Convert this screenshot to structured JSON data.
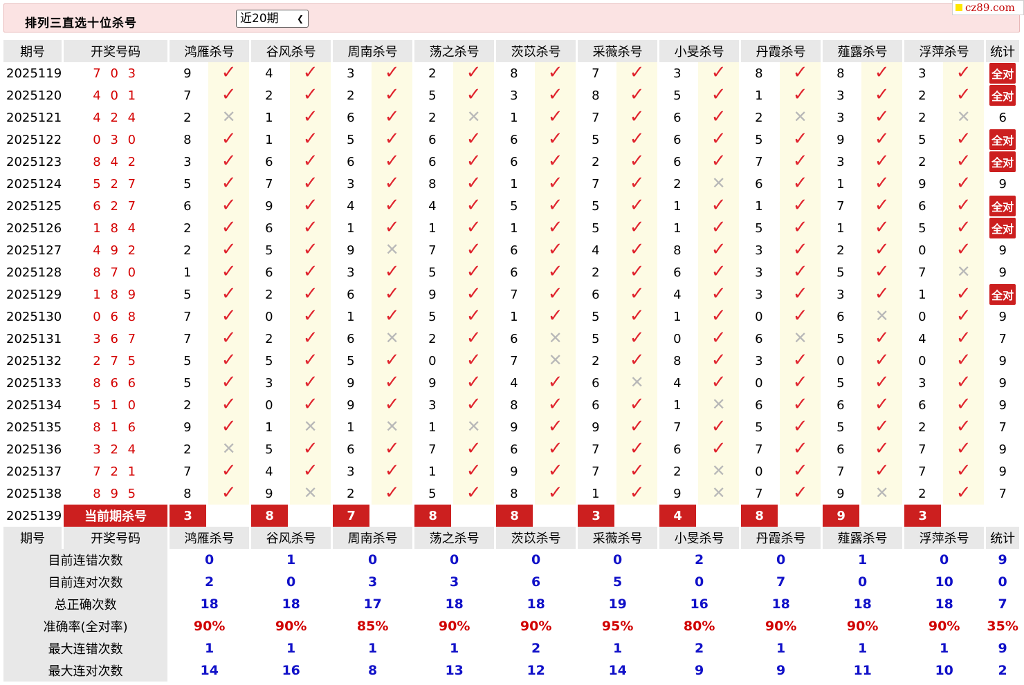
{
  "header": {
    "title": "排列三直选十位杀号",
    "period_select": "近20期",
    "logo": "cz89.com"
  },
  "columns": {
    "issue": "期号",
    "draw": "开奖号码",
    "experts": [
      "鸿雁杀号",
      "谷风杀号",
      "周南杀号",
      "荡之杀号",
      "茨苡杀号",
      "采薇杀号",
      "小旻杀号",
      "丹霞杀号",
      "薤露杀号",
      "浮萍杀号"
    ],
    "stats": "统计"
  },
  "rows": [
    {
      "issue": "2025119",
      "draw": "7 0 3",
      "kills": [
        "9",
        "4",
        "3",
        "2",
        "8",
        "7",
        "3",
        "8",
        "8",
        "3"
      ],
      "ok": [
        1,
        1,
        1,
        1,
        1,
        1,
        1,
        1,
        1,
        1
      ],
      "stat": "全对"
    },
    {
      "issue": "2025120",
      "draw": "4 0 1",
      "kills": [
        "7",
        "2",
        "2",
        "5",
        "3",
        "8",
        "5",
        "1",
        "3",
        "2"
      ],
      "ok": [
        1,
        1,
        1,
        1,
        1,
        1,
        1,
        1,
        1,
        1
      ],
      "stat": "全对"
    },
    {
      "issue": "2025121",
      "draw": "4 2 4",
      "kills": [
        "2",
        "1",
        "6",
        "2",
        "1",
        "7",
        "6",
        "2",
        "3",
        "2"
      ],
      "ok": [
        0,
        1,
        1,
        0,
        1,
        1,
        1,
        0,
        1,
        0
      ],
      "stat": "6"
    },
    {
      "issue": "2025122",
      "draw": "0 3 0",
      "kills": [
        "8",
        "1",
        "5",
        "6",
        "6",
        "5",
        "6",
        "5",
        "9",
        "5"
      ],
      "ok": [
        1,
        1,
        1,
        1,
        1,
        1,
        1,
        1,
        1,
        1
      ],
      "stat": "全对"
    },
    {
      "issue": "2025123",
      "draw": "8 4 2",
      "kills": [
        "3",
        "6",
        "6",
        "6",
        "6",
        "2",
        "6",
        "7",
        "3",
        "2"
      ],
      "ok": [
        1,
        1,
        1,
        1,
        1,
        1,
        1,
        1,
        1,
        1
      ],
      "stat": "全对"
    },
    {
      "issue": "2025124",
      "draw": "5 2 7",
      "kills": [
        "5",
        "7",
        "3",
        "8",
        "1",
        "7",
        "2",
        "6",
        "1",
        "9"
      ],
      "ok": [
        1,
        1,
        1,
        1,
        1,
        1,
        0,
        1,
        1,
        1
      ],
      "stat": "9"
    },
    {
      "issue": "2025125",
      "draw": "6 2 7",
      "kills": [
        "6",
        "9",
        "4",
        "4",
        "5",
        "5",
        "1",
        "1",
        "7",
        "6"
      ],
      "ok": [
        1,
        1,
        1,
        1,
        1,
        1,
        1,
        1,
        1,
        1
      ],
      "stat": "全对"
    },
    {
      "issue": "2025126",
      "draw": "1 8 4",
      "kills": [
        "2",
        "6",
        "1",
        "1",
        "1",
        "5",
        "1",
        "5",
        "1",
        "5"
      ],
      "ok": [
        1,
        1,
        1,
        1,
        1,
        1,
        1,
        1,
        1,
        1
      ],
      "stat": "全对"
    },
    {
      "issue": "2025127",
      "draw": "4 9 2",
      "kills": [
        "2",
        "5",
        "9",
        "7",
        "6",
        "4",
        "8",
        "3",
        "2",
        "0"
      ],
      "ok": [
        1,
        1,
        0,
        1,
        1,
        1,
        1,
        1,
        1,
        1
      ],
      "stat": "9"
    },
    {
      "issue": "2025128",
      "draw": "8 7 0",
      "kills": [
        "1",
        "6",
        "3",
        "5",
        "6",
        "2",
        "6",
        "3",
        "5",
        "7"
      ],
      "ok": [
        1,
        1,
        1,
        1,
        1,
        1,
        1,
        1,
        1,
        0
      ],
      "stat": "9"
    },
    {
      "issue": "2025129",
      "draw": "1 8 9",
      "kills": [
        "5",
        "2",
        "6",
        "9",
        "7",
        "6",
        "4",
        "3",
        "3",
        "1"
      ],
      "ok": [
        1,
        1,
        1,
        1,
        1,
        1,
        1,
        1,
        1,
        1
      ],
      "stat": "全对"
    },
    {
      "issue": "2025130",
      "draw": "0 6 8",
      "kills": [
        "7",
        "0",
        "1",
        "5",
        "1",
        "5",
        "1",
        "0",
        "6",
        "0"
      ],
      "ok": [
        1,
        1,
        1,
        1,
        1,
        1,
        1,
        1,
        0,
        1
      ],
      "stat": "9"
    },
    {
      "issue": "2025131",
      "draw": "3 6 7",
      "kills": [
        "7",
        "2",
        "6",
        "2",
        "6",
        "5",
        "0",
        "6",
        "5",
        "4"
      ],
      "ok": [
        1,
        1,
        0,
        1,
        0,
        1,
        1,
        0,
        1,
        1
      ],
      "stat": "7"
    },
    {
      "issue": "2025132",
      "draw": "2 7 5",
      "kills": [
        "5",
        "5",
        "5",
        "0",
        "7",
        "2",
        "8",
        "3",
        "0",
        "0"
      ],
      "ok": [
        1,
        1,
        1,
        1,
        0,
        1,
        1,
        1,
        1,
        1
      ],
      "stat": "9"
    },
    {
      "issue": "2025133",
      "draw": "8 6 6",
      "kills": [
        "5",
        "3",
        "9",
        "9",
        "4",
        "6",
        "4",
        "0",
        "5",
        "3"
      ],
      "ok": [
        1,
        1,
        1,
        1,
        1,
        0,
        1,
        1,
        1,
        1
      ],
      "stat": "9"
    },
    {
      "issue": "2025134",
      "draw": "5 1 0",
      "kills": [
        "2",
        "0",
        "9",
        "3",
        "8",
        "6",
        "1",
        "6",
        "6",
        "6"
      ],
      "ok": [
        1,
        1,
        1,
        1,
        1,
        1,
        0,
        1,
        1,
        1
      ],
      "stat": "9"
    },
    {
      "issue": "2025135",
      "draw": "8 1 6",
      "kills": [
        "9",
        "1",
        "1",
        "1",
        "9",
        "9",
        "7",
        "5",
        "5",
        "2"
      ],
      "ok": [
        1,
        0,
        0,
        0,
        1,
        1,
        1,
        1,
        1,
        1
      ],
      "stat": "7"
    },
    {
      "issue": "2025136",
      "draw": "3 2 4",
      "kills": [
        "2",
        "5",
        "6",
        "7",
        "6",
        "7",
        "6",
        "7",
        "6",
        "7"
      ],
      "ok": [
        0,
        1,
        1,
        1,
        1,
        1,
        1,
        1,
        1,
        1
      ],
      "stat": "9"
    },
    {
      "issue": "2025137",
      "draw": "7 2 1",
      "kills": [
        "7",
        "4",
        "3",
        "1",
        "9",
        "7",
        "2",
        "0",
        "7",
        "7"
      ],
      "ok": [
        1,
        1,
        1,
        1,
        1,
        1,
        0,
        1,
        1,
        1
      ],
      "stat": "9"
    },
    {
      "issue": "2025138",
      "draw": "8 9 5",
      "kills": [
        "8",
        "9",
        "2",
        "5",
        "8",
        "1",
        "9",
        "7",
        "9",
        "2"
      ],
      "ok": [
        1,
        0,
        1,
        1,
        1,
        1,
        0,
        1,
        0,
        1
      ],
      "stat": "7"
    }
  ],
  "current": {
    "issue": "2025139",
    "label": "当前期杀号",
    "kills": [
      "3",
      "8",
      "7",
      "8",
      "8",
      "3",
      "4",
      "8",
      "9",
      "3"
    ]
  },
  "stats_rows": [
    {
      "label": "目前连错次数",
      "values": [
        "0",
        "1",
        "0",
        "0",
        "0",
        "0",
        "2",
        "0",
        "1",
        "0"
      ],
      "total": "9",
      "kind": "n"
    },
    {
      "label": "目前连对次数",
      "values": [
        "2",
        "0",
        "3",
        "3",
        "6",
        "5",
        "0",
        "7",
        "0",
        "10"
      ],
      "total": "0",
      "kind": "n"
    },
    {
      "label": "总正确次数",
      "values": [
        "18",
        "18",
        "17",
        "18",
        "18",
        "19",
        "16",
        "18",
        "18",
        "18"
      ],
      "total": "7",
      "kind": "n"
    },
    {
      "label": "准确率(全对率)",
      "values": [
        "90%",
        "90%",
        "85%",
        "90%",
        "90%",
        "95%",
        "80%",
        "90%",
        "90%",
        "90%"
      ],
      "total": "35%",
      "kind": "r"
    },
    {
      "label": "最大连错次数",
      "values": [
        "1",
        "1",
        "1",
        "1",
        "2",
        "1",
        "2",
        "1",
        "1",
        "1"
      ],
      "total": "9",
      "kind": "n"
    },
    {
      "label": "最大连对次数",
      "values": [
        "14",
        "16",
        "8",
        "13",
        "12",
        "14",
        "9",
        "9",
        "11",
        "10"
      ],
      "total": "2",
      "kind": "n"
    }
  ],
  "icons": {
    "correct": "check-icon",
    "wrong": "cross-icon"
  },
  "colors": {
    "accent_red": "#cc1f1f",
    "stat_blue": "#1010c8",
    "header_bg": "#fbe3e3",
    "mark_bg": "#fdfbe4"
  }
}
